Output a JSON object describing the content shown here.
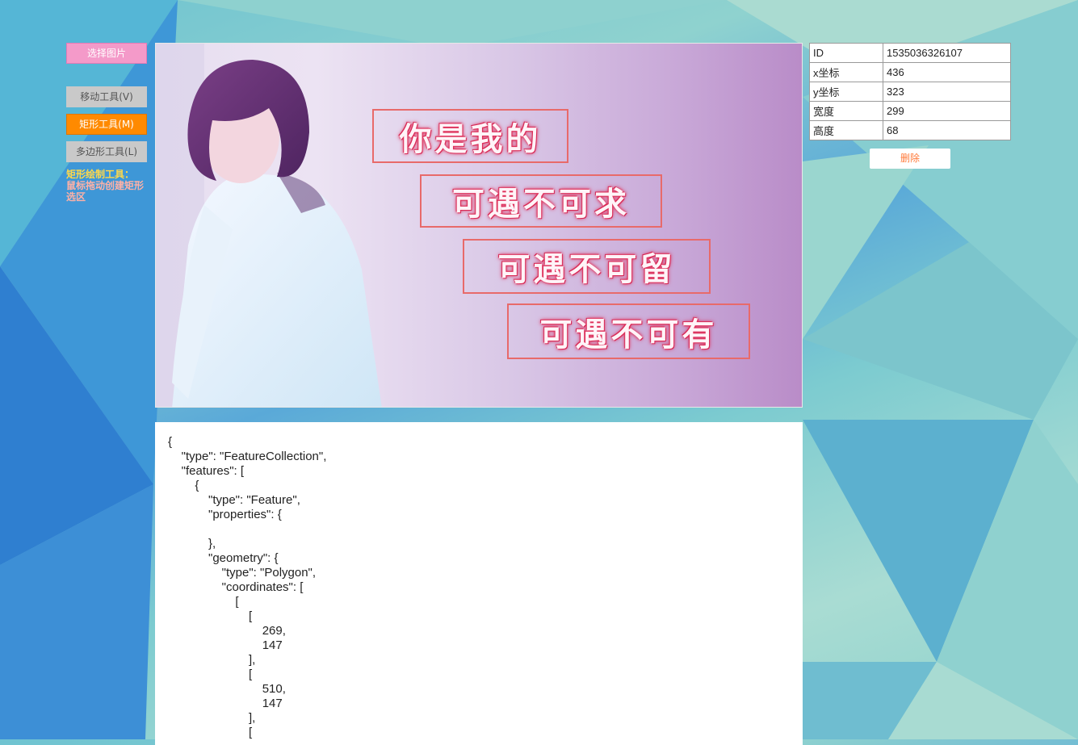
{
  "toolbar": {
    "choose_image": "选择图片",
    "move_tool": "移动工具(V)",
    "rect_tool": "矩形工具(M)",
    "polygon_tool": "多边形工具(L)",
    "hint_title": "矩形绘制工具：",
    "hint_desc": "鼠标拖动创建矩形选区"
  },
  "image": {
    "text_lines": [
      "你是我的",
      "可遇不可求",
      "可遇不可留",
      "可遇不可有"
    ]
  },
  "properties": {
    "rows": [
      {
        "label": "ID",
        "value": "1535036326107"
      },
      {
        "label": "x坐标",
        "value": "436"
      },
      {
        "label": "y坐标",
        "value": "323"
      },
      {
        "label": "宽度",
        "value": "299"
      },
      {
        "label": "高度",
        "value": "68"
      }
    ],
    "delete_label": "删除"
  },
  "geojson_text": "{\n    \"type\": \"FeatureCollection\",\n    \"features\": [\n        {\n            \"type\": \"Feature\",\n            \"properties\": {\n\n            },\n            \"geometry\": {\n                \"type\": \"Polygon\",\n                \"coordinates\": [\n                    [\n                        [\n                            269,\n                            147\n                        ],\n                        [\n                            510,\n                            147\n                        ],\n                        ["
}
